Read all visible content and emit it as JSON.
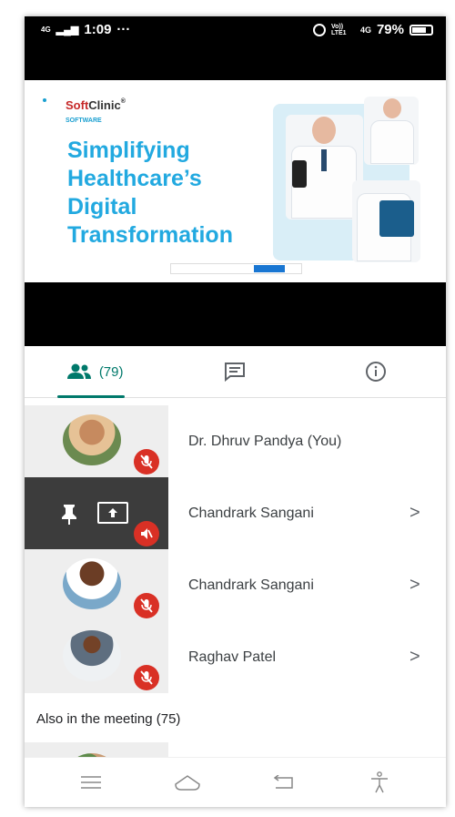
{
  "status_bar": {
    "signal_text": "4G",
    "time": "1:09",
    "overflow": "···",
    "volte_text": "Vo)) LTE1",
    "network_text": "4G",
    "battery": "79%"
  },
  "presentation": {
    "brand_soft": "Soft",
    "brand_clinic": "Clinic",
    "brand_mark": "®",
    "brand_sub": "SOFTWARE",
    "headline_line1": "Simplifying",
    "headline_line2": "Healthcare’s",
    "headline_line3": "Digital",
    "headline_line4": "Transformation"
  },
  "tabs": {
    "people_count": "(79)",
    "people_icon": "people-icon",
    "chat_icon": "chat-icon",
    "info_icon": "info-icon"
  },
  "participants": [
    {
      "name": "Dr. Dhruv Pandya (You)",
      "muted": true,
      "presenting": false,
      "has_chevron": false
    },
    {
      "name": "Chandrark Sangani",
      "muted": true,
      "presenting": true,
      "has_chevron": true
    },
    {
      "name": "Chandrark Sangani",
      "muted": true,
      "presenting": false,
      "has_chevron": true
    },
    {
      "name": "Raghav Patel",
      "muted": true,
      "presenting": false,
      "has_chevron": true
    }
  ],
  "chevron": ">",
  "also_in_meeting": "Also in the meeting (75)",
  "nav_bar": [
    "menu-icon",
    "home-icon",
    "back-icon",
    "accessibility-icon"
  ],
  "colors": {
    "accent": "#00796b",
    "mute_red": "#d93025",
    "headline_blue": "#22a9e0",
    "brand_red": "#c62828"
  }
}
